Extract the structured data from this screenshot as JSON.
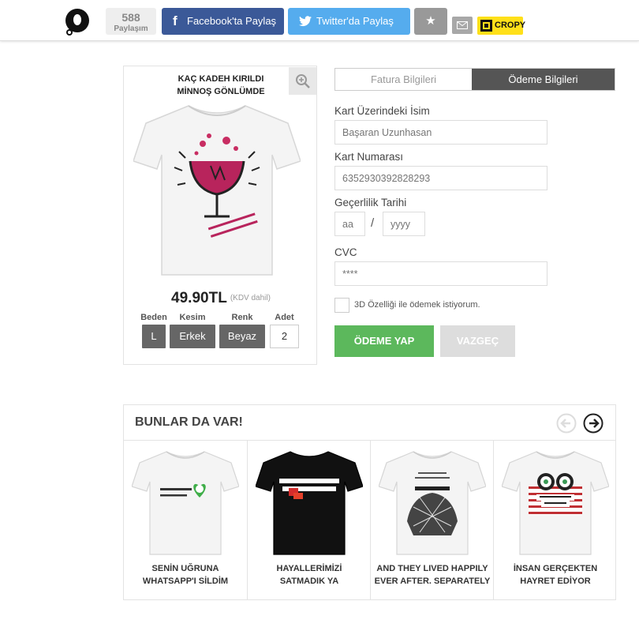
{
  "header": {
    "share_count": "588",
    "share_count_label": "Paylaşım",
    "facebook_label": "Facebook'ta Paylaş",
    "twitter_label": "Twitter'da Paylaş",
    "cropy_label": "CROPY",
    "colors": {
      "facebook": "#3b5998",
      "twitter": "#55acee",
      "cropy": "#ffe019"
    }
  },
  "product": {
    "title": "KAÇ KADEH KIRILDI\nMİNNOŞ GÖNLÜMDE",
    "price": "49.90TL",
    "vat_note": "(KDV dahil)",
    "options": [
      {
        "label": "Beden",
        "value": "L"
      },
      {
        "label": "Kesim",
        "value": "Erkek"
      },
      {
        "label": "Renk",
        "value": "Beyaz"
      },
      {
        "label": "Adet",
        "value": "2"
      }
    ]
  },
  "payment": {
    "tabs": [
      {
        "label": "Fatura Bilgileri",
        "active": false
      },
      {
        "label": "Ödeme Bilgileri",
        "active": true
      }
    ],
    "card_name_label": "Kart Üzerindeki İsim",
    "card_name_placeholder": "Başaran Uzunhasan",
    "card_number_label": "Kart Numarası",
    "card_number_placeholder": "6352930392828293",
    "expiry_label": "Geçerlilik Tarihi",
    "expiry_month_placeholder": "aa",
    "expiry_separator": "/",
    "expiry_year_placeholder": "yyyy",
    "cvc_label": "CVC",
    "cvc_placeholder": "****",
    "secure_3d_label": "3D Özelliği ile ödemek istiyorum.",
    "pay_button": "ÖDEME YAP",
    "cancel_button": "VAZGEÇ",
    "colors": {
      "pay": "#5cb85c",
      "active_tab": "#555555"
    }
  },
  "related": {
    "title": "BUNLAR DA VAR!",
    "items": [
      {
        "name": "SENİN UĞRUNA\nWHATSAPP'I SİLDİM",
        "shirt_color": "white"
      },
      {
        "name": "HAYALLERİMİZİ\nSATMADIK YA",
        "shirt_color": "black"
      },
      {
        "name": "AND THEY LIVED HAPPILY\nEVER AFTER. SEPARATELY",
        "shirt_color": "white"
      },
      {
        "name": "İNSAN GERÇEKTEN\nHAYRET EDİYOR",
        "shirt_color": "white"
      }
    ]
  }
}
